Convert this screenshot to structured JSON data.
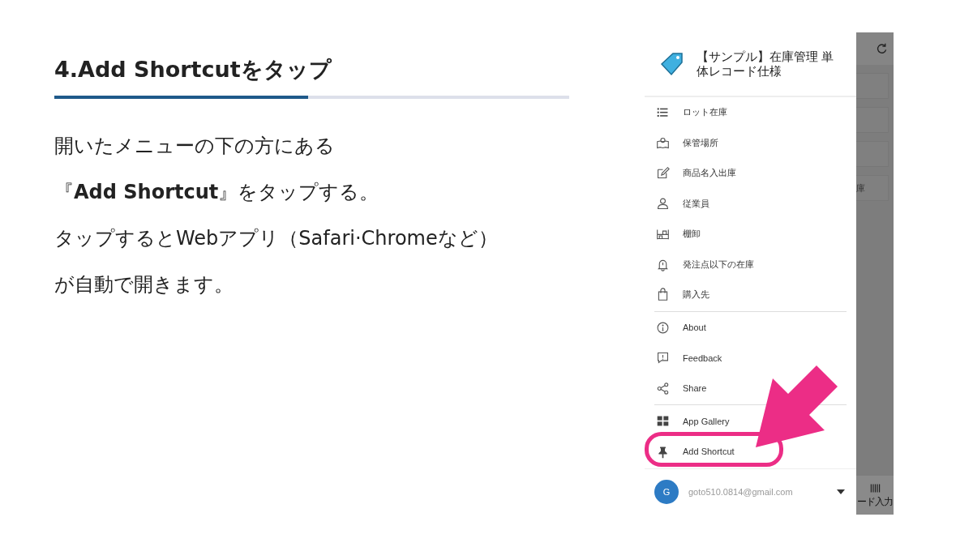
{
  "heading": "4.Add Shortcutをタップ",
  "body": [
    "開いたメニューの下の方にある",
    "『**Add Shortcut**』をタップする。",
    "タップするとWebアプリ（Safari·Chromeなど）",
    "が自動で開きます。"
  ],
  "app": {
    "title": "【サンプル】在庫管理 単体レコード仕様",
    "menu_groups": [
      {
        "items": [
          "ロット在庫",
          "保管場所",
          "商品名入出庫",
          "従業員",
          "棚卸",
          "発注点以下の在庫",
          "購入先"
        ]
      },
      {
        "items": [
          "About",
          "Feedback",
          "Share"
        ]
      },
      {
        "items": [
          "App Gallery",
          "Add Shortcut"
        ]
      }
    ],
    "account": {
      "initial": "G",
      "email": "goto510.0814@gmail.com"
    },
    "background_texts": [
      "庫",
      "ード入力"
    ]
  }
}
